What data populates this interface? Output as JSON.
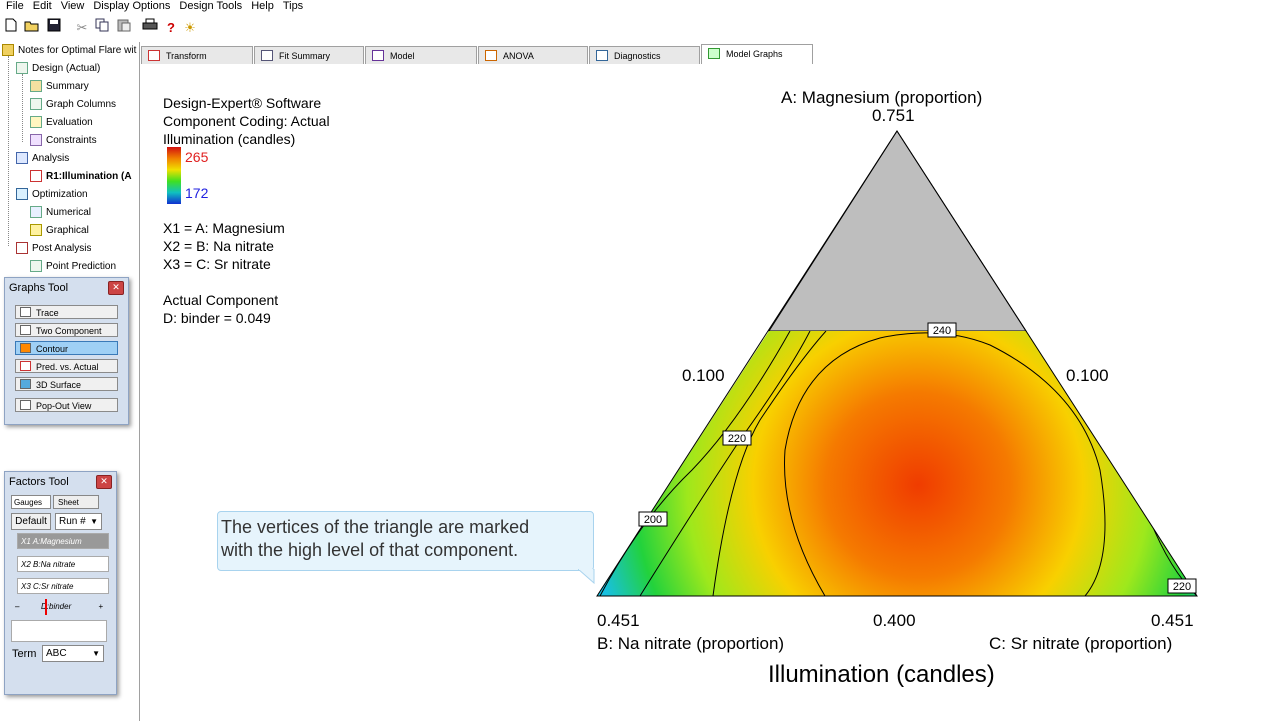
{
  "menu": [
    "File",
    "Edit",
    "View",
    "Display Options",
    "Design Tools",
    "Help",
    "Tips"
  ],
  "toolbar_icons": [
    "new-icon",
    "open-icon",
    "save-icon",
    "cut-icon",
    "copy-icon",
    "paste-icon",
    "print-icon",
    "help-icon",
    "tip-icon"
  ],
  "tree": {
    "root": "Notes for Optimal Flare wit",
    "design": "Design (Actual)",
    "summary": "Summary",
    "graph_columns": "Graph Columns",
    "evaluation": "Evaluation",
    "constraints": "Constraints",
    "analysis": "Analysis",
    "response": "R1:Illumination (A",
    "optimization": "Optimization",
    "numerical": "Numerical",
    "graphical": "Graphical",
    "post_analysis": "Post Analysis",
    "point_prediction": "Point Prediction"
  },
  "graphs_tool": {
    "title": "Graphs Tool",
    "trace": "Trace",
    "two_component": "Two Component",
    "contour": "Contour",
    "pred_actual": "Pred. vs. Actual",
    "surface": "3D Surface",
    "popout": "Pop-Out View"
  },
  "factors_tool": {
    "title": "Factors Tool",
    "gauges": "Gauges",
    "sheet": "Sheet",
    "default": "Default",
    "run": "Run #",
    "x1": "X1 A:Magnesium",
    "x2": "X2 B:Na nitrate",
    "x3": "X3 C:Sr nitrate",
    "slider_minus": "–",
    "slider_label": "D:binder",
    "slider_plus": "+",
    "term_label": "Term",
    "term_value": "ABC"
  },
  "tabs": [
    "Transform",
    "Fit Summary",
    "Model",
    "ANOVA",
    "Diagnostics",
    "Model Graphs"
  ],
  "legend": {
    "line1": "Design-Expert® Software",
    "line2": "Component Coding: Actual",
    "line3": "Illumination (candles)",
    "high": "265",
    "low": "172",
    "high_color": "#e02020",
    "low_color": "#2020e0",
    "x1": "X1 = A: Magnesium",
    "x2": "X2 = B: Na nitrate",
    "x3": "X3 = C: Sr nitrate",
    "actual_label": "Actual Component",
    "actual_value": "D: binder = 0.049"
  },
  "plot": {
    "top_title": "A: Magnesium (proportion)",
    "top_value": "0.751",
    "left_mid": "0.100",
    "right_mid": "0.100",
    "bottom_left": "0.451",
    "bottom_mid": "0.400",
    "bottom_right": "0.451",
    "axis_b": "B: Na nitrate (proportion)",
    "axis_c": "C: Sr nitrate (proportion)",
    "title": "Illumination (candles)",
    "contour_labels": [
      "240",
      "220",
      "200",
      "220"
    ]
  },
  "callout": {
    "line1": "The vertices of the triangle are marked",
    "line2": "with the high level of that component."
  }
}
